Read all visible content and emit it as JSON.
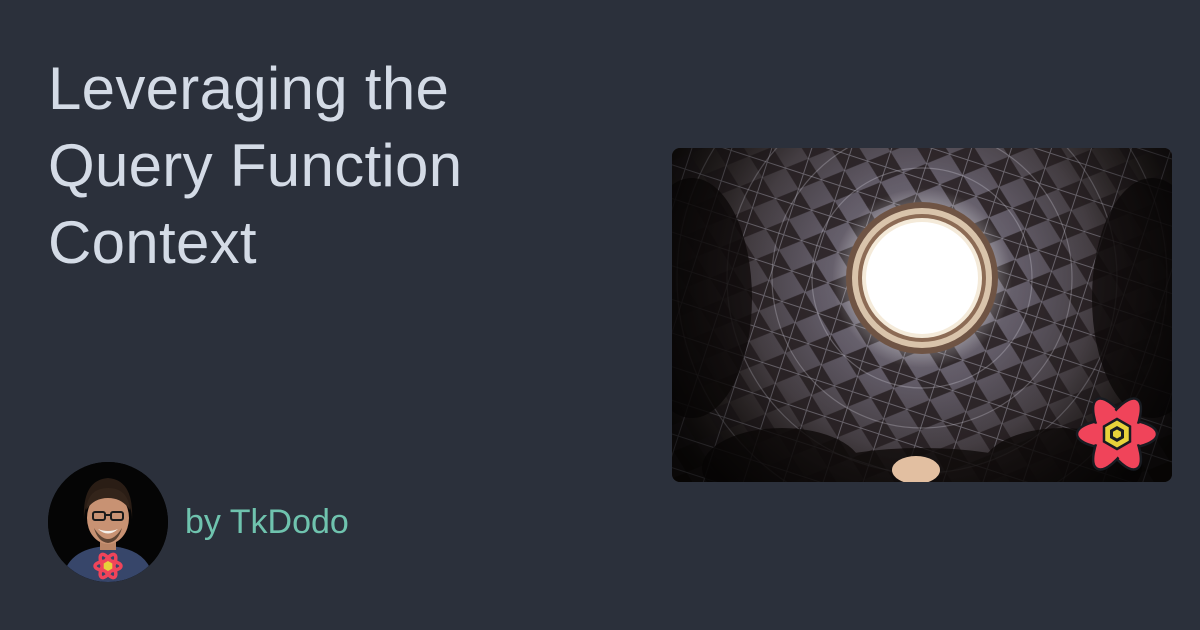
{
  "title": {
    "line1": "Leveraging the",
    "line2": "Query Function",
    "line3": "Context"
  },
  "author": {
    "byline": "by TkDodo"
  },
  "hero": {
    "icon": "dome-photo"
  },
  "logo": {
    "icon": "react-query-logo",
    "color": "#f0445a"
  },
  "colors": {
    "background": "#2b303b",
    "title": "#d4dbe6",
    "byline": "#6fc3ae"
  }
}
